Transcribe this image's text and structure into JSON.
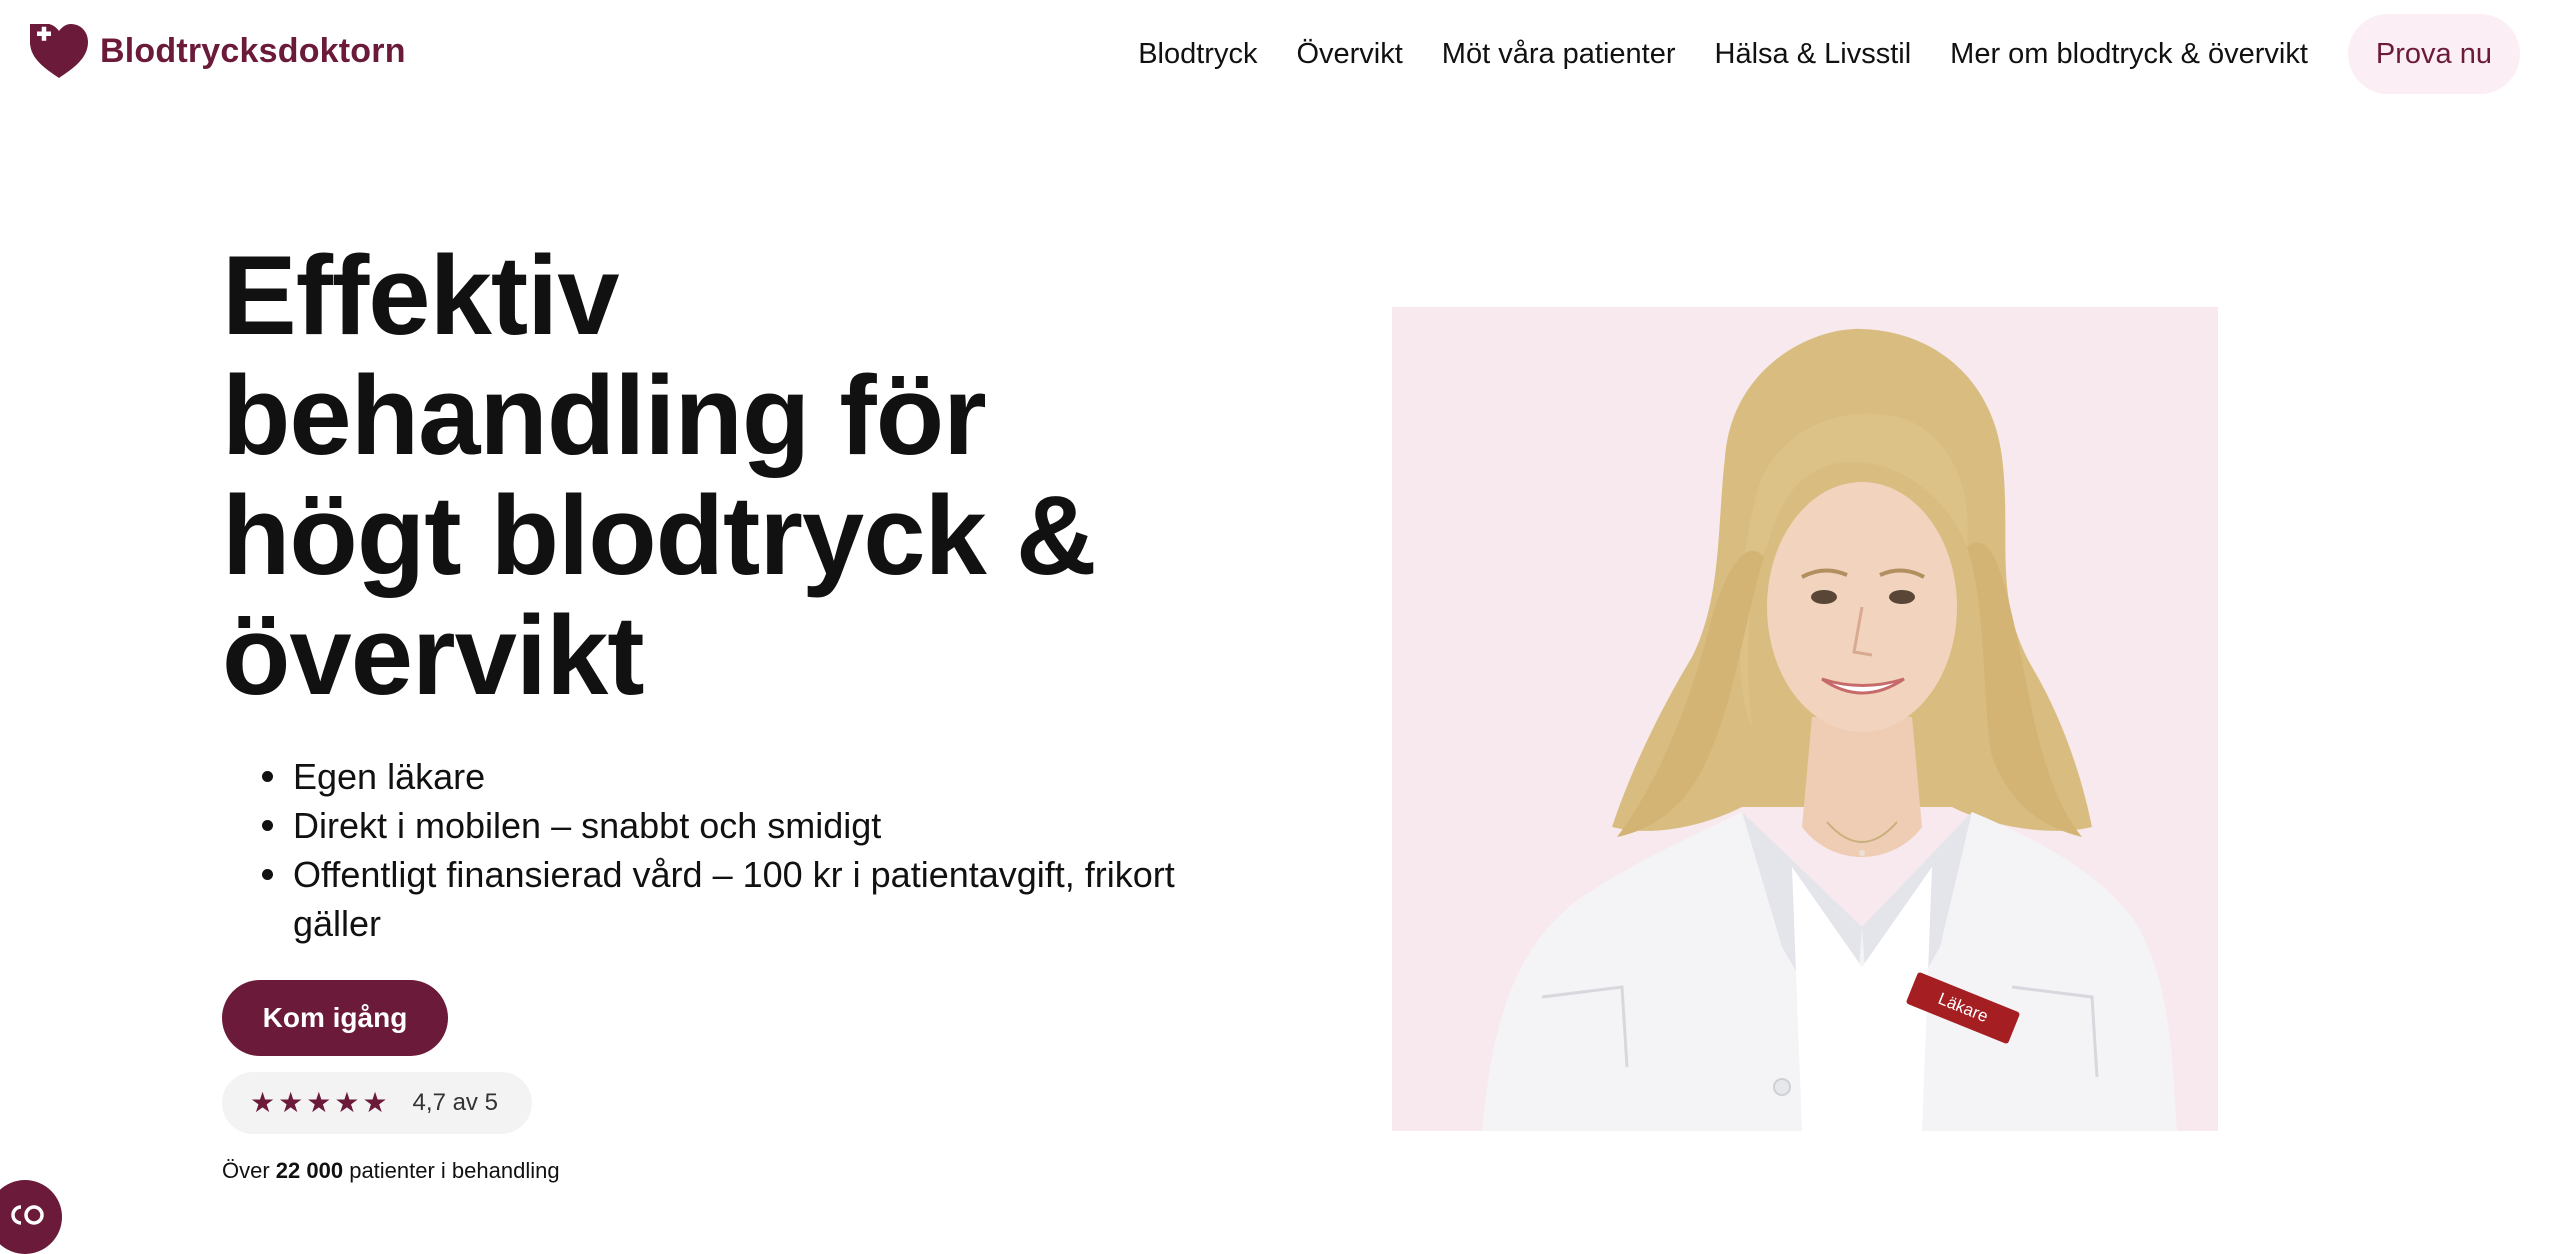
{
  "brand": {
    "name": "Blodtrycksdoktorn",
    "logo_icon": "heart-plus-logo",
    "primary_color": "#6b1a3a",
    "soft_color": "#fbeef4",
    "image_background": "#f7e9ee"
  },
  "nav": {
    "items": [
      {
        "label": "Blodtryck"
      },
      {
        "label": "Övervikt"
      },
      {
        "label": "Möt våra patienter"
      },
      {
        "label": "Hälsa & Livsstil"
      },
      {
        "label": "Mer om blodtryck & övervikt"
      }
    ],
    "cta_label": "Prova nu"
  },
  "hero": {
    "title_lines": [
      "Effektiv",
      "behandling för",
      "högt blodtryck &",
      "övervikt"
    ],
    "benefits": [
      {
        "text": "Egen läkare"
      },
      {
        "text": "Direkt i mobilen – snabbt och smidigt"
      },
      {
        "text": "Offentligt finansierad vård – 100 kr i patientavgift, frikort"
      },
      {
        "text": "gäller"
      }
    ],
    "cta_label": "Kom igång",
    "rating": {
      "stars": 5,
      "star_glyph": "★",
      "text": "4,7 av 5"
    },
    "patients": {
      "prefix": "Över ",
      "count": "22 000",
      "suffix": " patienter i behandling"
    }
  },
  "doctor_image": {
    "badge_text": "Läkare",
    "description_icon": "doctor-portrait"
  },
  "chat": {
    "icon": "chat-launcher-icon"
  }
}
